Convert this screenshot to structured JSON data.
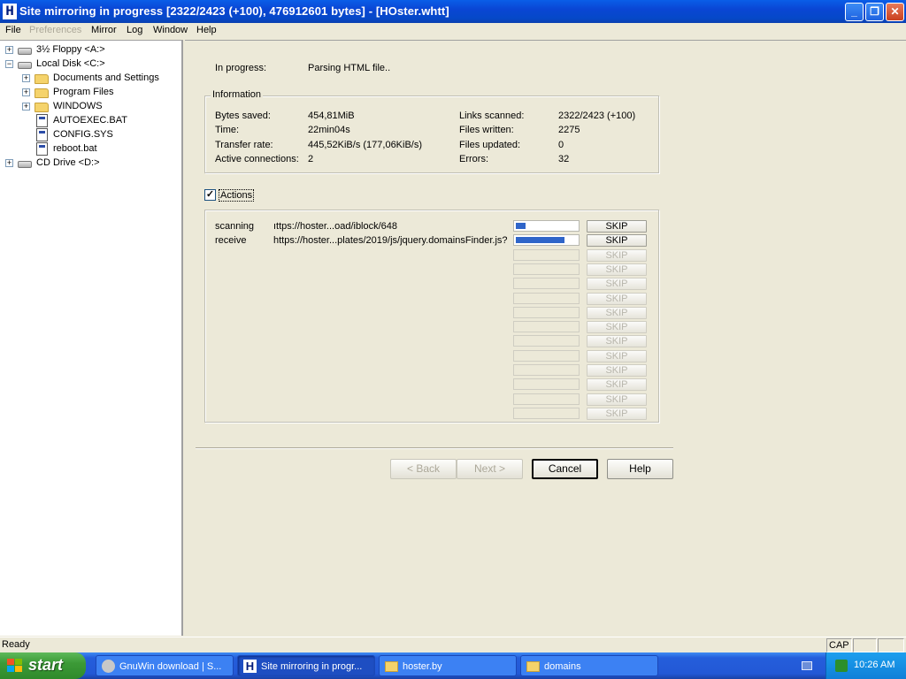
{
  "window": {
    "title": "Site mirroring in progress [2322/2423 (+100), 476912601 bytes] - [HOster.whtt]",
    "app_icon_letter": "H"
  },
  "menu": {
    "file": "File",
    "preferences": "Preferences",
    "mirror": "Mirror",
    "log": "Log",
    "window": "Window",
    "help": "Help"
  },
  "tree": {
    "items": [
      {
        "label": "3½ Floppy <A:>",
        "icon": "floppy-icon"
      },
      {
        "label": "Local Disk <C:>",
        "icon": "hard-disk-icon"
      },
      {
        "label": "Documents and Settings",
        "icon": "folder-icon"
      },
      {
        "label": "Program Files",
        "icon": "folder-icon"
      },
      {
        "label": "WINDOWS",
        "icon": "folder-icon"
      },
      {
        "label": "AUTOEXEC.BAT",
        "icon": "batch-file-icon"
      },
      {
        "label": "CONFIG.SYS",
        "icon": "system-file-icon"
      },
      {
        "label": "reboot.bat",
        "icon": "batch-file-icon"
      },
      {
        "label": "CD Drive <D:>",
        "icon": "cd-drive-icon"
      }
    ]
  },
  "progress": {
    "label": "In progress:",
    "value": "Parsing HTML file.."
  },
  "information": {
    "legend": "Information",
    "bytes_saved_label": "Bytes saved:",
    "bytes_saved": "454,81MiB",
    "time_label": "Time:",
    "time": "22min04s",
    "transfer_rate_label": "Transfer rate:",
    "transfer_rate": "445,52KiB/s (177,06KiB/s)",
    "active_connections_label": "Active connections:",
    "active_connections": "2",
    "links_scanned_label": "Links scanned:",
    "links_scanned": "2322/2423 (+100)",
    "files_written_label": "Files written:",
    "files_written": "2275",
    "files_updated_label": "Files updated:",
    "files_updated": "0",
    "errors_label": "Errors:",
    "errors": "32"
  },
  "actions": {
    "label": "Actions",
    "checked": true,
    "skip_label": "SKIP",
    "rows": [
      {
        "status": "scanning",
        "url": "ıttps://hoster...oad/iblock/648",
        "progress": 0.15
      },
      {
        "status": "receive",
        "url": "https://hoster...plates/2019/js/jquery.domainsFinder.js?",
        "progress": 0.78
      }
    ],
    "empty_rows": 12
  },
  "buttons": {
    "back": "< Back",
    "next": "Next >",
    "cancel": "Cancel",
    "help": "Help"
  },
  "statusbar": {
    "text": "Ready",
    "cap": "CAP"
  },
  "taskbar": {
    "start": "start",
    "tasks": [
      {
        "label": "GnuWin download | S...",
        "icon": "browser-icon"
      },
      {
        "label": "Site mirroring in progr...",
        "icon": "httrack-icon"
      },
      {
        "label": "hoster.by",
        "icon": "folder-icon"
      },
      {
        "label": "domains",
        "icon": "folder-icon"
      }
    ],
    "clock": "10:26 AM"
  }
}
